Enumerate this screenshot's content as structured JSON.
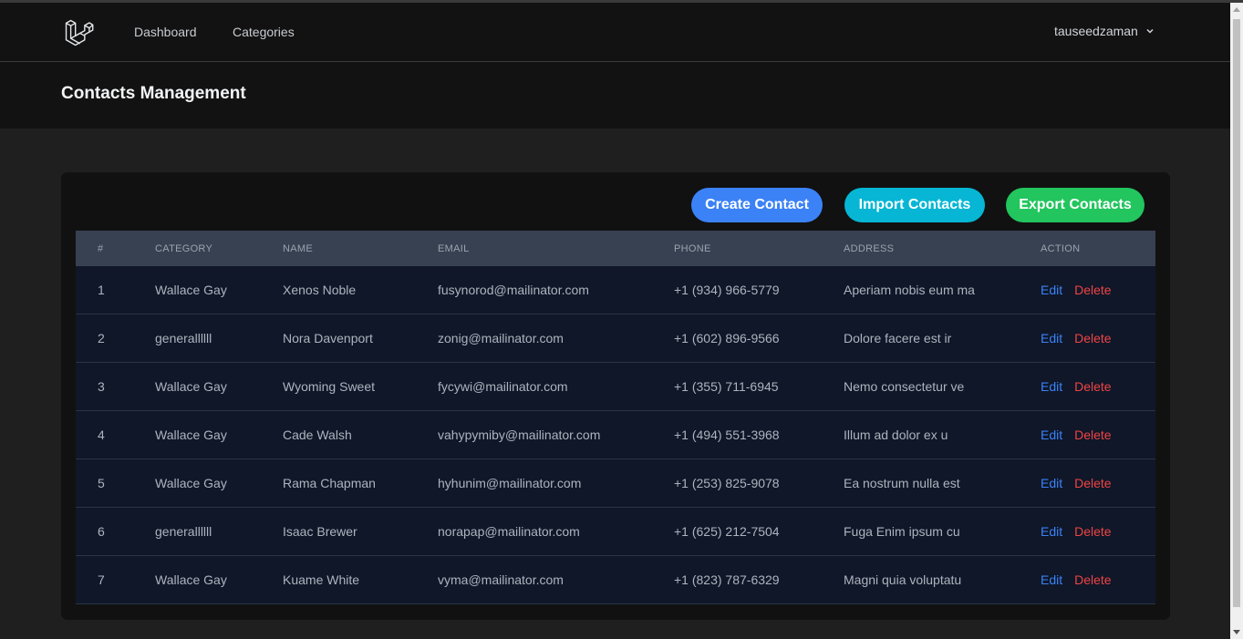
{
  "nav": {
    "links": [
      "Dashboard",
      "Categories"
    ],
    "user": "tauseedzaman"
  },
  "header": {
    "title": "Contacts Management"
  },
  "toolbar": {
    "create_label": "Create Contact",
    "import_label": "Import Contacts",
    "export_label": "Export Contacts"
  },
  "colors": {
    "create": "#3b82f6",
    "import": "#06b6d4",
    "export": "#22c55e",
    "edit": "#3b82f6",
    "delete": "#ef4444"
  },
  "table": {
    "columns": [
      "#",
      "Category",
      "Name",
      "Email",
      "Phone",
      "Address",
      "Action"
    ],
    "rows": [
      [
        "1",
        "Wallace Gay",
        "Xenos Noble",
        "fusynorod@mailinator.com",
        "+1 (934) 966-5779",
        "Aperiam nobis eum ma"
      ],
      [
        "2",
        "generallllll",
        "Nora Davenport",
        "zonig@mailinator.com",
        "+1 (602) 896-9566",
        "Dolore facere est ir"
      ],
      [
        "3",
        "Wallace Gay",
        "Wyoming Sweet",
        "fycywi@mailinator.com",
        "+1 (355) 711-6945",
        "Nemo consectetur ve"
      ],
      [
        "4",
        "Wallace Gay",
        "Cade Walsh",
        "vahypymiby@mailinator.com",
        "+1 (494) 551-3968",
        "Illum ad dolor ex u"
      ],
      [
        "5",
        "Wallace Gay",
        "Rama Chapman",
        "hyhunim@mailinator.com",
        "+1 (253) 825-9078",
        "Ea nostrum nulla est"
      ],
      [
        "6",
        "generallllll",
        "Isaac Brewer",
        "norapap@mailinator.com",
        "+1 (625) 212-7504",
        "Fuga Enim ipsum cu"
      ],
      [
        "7",
        "Wallace Gay",
        "Kuame White",
        "vyma@mailinator.com",
        "+1 (823) 787-6329",
        "Magni quia voluptatu"
      ]
    ],
    "edit_label": "Edit",
    "delete_label": "Delete"
  },
  "icons": {
    "logo": "laravel-logo-icon",
    "user_menu": "chevron-down-icon"
  }
}
